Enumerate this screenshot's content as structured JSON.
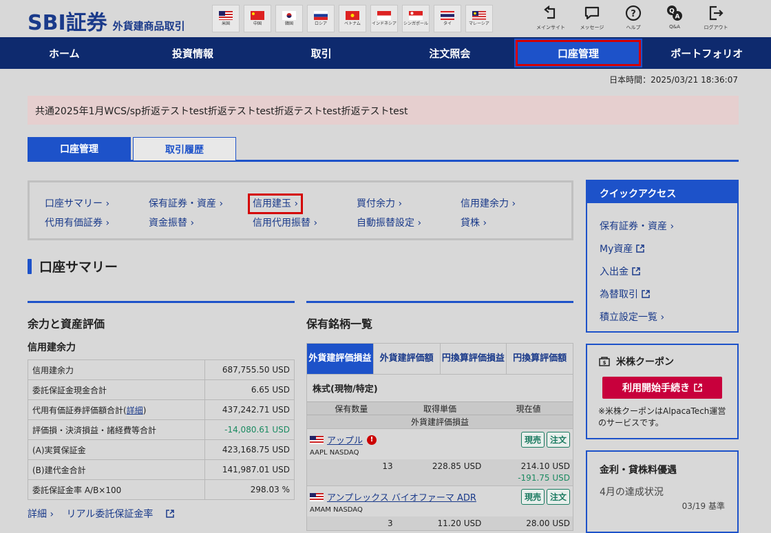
{
  "header": {
    "logo": "SBI証券",
    "subtitle": "外貨建商品取引",
    "flags": [
      {
        "label": "米国",
        "icon": "us-flag-icon"
      },
      {
        "label": "中国",
        "icon": "cn-flag-icon"
      },
      {
        "label": "韓国",
        "icon": "kr-flag-icon"
      },
      {
        "label": "ロシア",
        "icon": "ru-flag-icon"
      },
      {
        "label": "ベトナム",
        "icon": "vn-flag-icon"
      },
      {
        "label": "インドネシア",
        "icon": "id-flag-icon"
      },
      {
        "label": "シンガポール",
        "icon": "sg-flag-icon"
      },
      {
        "label": "タイ",
        "icon": "th-flag-icon"
      },
      {
        "label": "マレーシア",
        "icon": "my-flag-icon"
      }
    ],
    "tools": [
      {
        "label": "メインサイト",
        "icon": "main-site-icon"
      },
      {
        "label": "メッセージ",
        "icon": "message-icon"
      },
      {
        "label": "ヘルプ",
        "icon": "help-icon"
      },
      {
        "label": "Q&A",
        "icon": "qa-icon"
      },
      {
        "label": "ログアウト",
        "icon": "logout-icon"
      }
    ]
  },
  "nav": [
    "ホーム",
    "投資情報",
    "取引",
    "注文照会",
    "口座管理",
    "ポートフォリオ"
  ],
  "time": "日本時間：2025/03/21 18:36:07",
  "notice": "共通2025年1月WCS/sp折返テストtest折返テストtest折返テストtest折返テストtest",
  "tabs": [
    "口座管理",
    "取引履歴"
  ],
  "submenu": [
    "口座サマリー ›",
    "保有証券・資産 ›",
    "信用建玉 ›",
    "買付余力 ›",
    "信用建余力 ›",
    "代用有価証券 ›",
    "資金振替 ›",
    "信用代用振替 ›",
    "自動振替設定 ›",
    "貸株 ›"
  ],
  "section_title": "口座サマリー",
  "balance": {
    "title": "余力と資産評価",
    "subtitle": "信用建余力",
    "rows": [
      {
        "label": "信用建余力",
        "value": "687,755.50 USD"
      },
      {
        "label": "委託保証金現金合計",
        "value": "6.65 USD"
      },
      {
        "label": "代用有価証券評価額合計(",
        "link": "詳細",
        "label_end": ")",
        "value": "437,242.71 USD"
      },
      {
        "label": "評価損・決済損益・諸経費等合計",
        "value": "-14,080.61 USD"
      },
      {
        "label": "(A)実質保証金",
        "value": "423,168.75 USD"
      },
      {
        "label": "(B)建代金合計",
        "value": "141,987.01 USD"
      },
      {
        "label": "委託保証金率 A/B×100",
        "value": "298.03 %"
      }
    ],
    "links": [
      "詳細 ›",
      "リアル委託保証金率"
    ]
  },
  "holdings": {
    "title": "保有銘柄一覧",
    "tabs": [
      [
        "外貨建",
        "評価損益"
      ],
      [
        "外貨建",
        "評価額"
      ],
      [
        "円換算",
        "評価損益"
      ],
      [
        "円換算",
        "評価額"
      ]
    ],
    "box_title": "株式(現物/特定)",
    "head": [
      "保有数量",
      "取得単価",
      "現在値"
    ],
    "head2": "外貨建評価損益",
    "stocks": [
      {
        "name": "アップル",
        "market": "AAPL NASDAQ",
        "qty": "13",
        "cost": "228.85 USD",
        "price": "214.10 USD",
        "pl": "-191.75 USD",
        "btn1": "現売",
        "btn2": "注文"
      },
      {
        "name": "アンプレックス バイオファーマ ADR",
        "market": "AMAM NASDAQ",
        "qty": "3",
        "cost": "11.20 USD",
        "price": "28.00 USD",
        "pl": "",
        "btn1": "現売",
        "btn2": "注文"
      }
    ]
  },
  "quick_access": {
    "title": "クイックアクセス",
    "items": [
      "保有証券・資産 ›",
      "My資産",
      "入出金",
      "為替取引",
      "積立設定一覧 ›"
    ]
  },
  "coupon": {
    "title": "米株クーポン",
    "button": "利用開始手続き",
    "note": "※米株クーポンはAlpacaTech運営のサービスです。"
  },
  "rate": {
    "title": "金利・貸株料優遇",
    "sub": "4月の達成状況",
    "date": "03/19 基準"
  }
}
